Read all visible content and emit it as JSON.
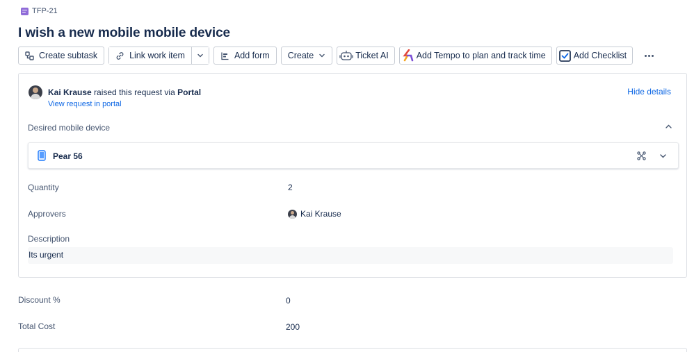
{
  "issue": {
    "key": "TFP-21",
    "title": "I wish a new mobile mobile device"
  },
  "toolbar": {
    "create_subtask": "Create subtask",
    "link_work_item": "Link work item",
    "add_form": "Add form",
    "create": "Create",
    "ticket_ai": "Ticket AI",
    "add_tempo": "Add Tempo to plan and track time",
    "add_checklist": "Add Checklist"
  },
  "request": {
    "requester_name": "Kai Krause",
    "raised_text": "raised this request via",
    "channel": "Portal",
    "view_link": "View request in portal",
    "hide_details": "Hide details"
  },
  "fields": {
    "desired_device_label": "Desired mobile device",
    "device_name": "Pear 56",
    "quantity_label": "Quantity",
    "quantity_value": "2",
    "approvers_label": "Approvers",
    "approver_name": "Kai Krause",
    "description_label": "Description",
    "description_value": "Its urgent",
    "discount_label": "Discount %",
    "discount_value": "0",
    "total_cost_label": "Total Cost",
    "total_cost_value": "200"
  },
  "icons": {
    "issue_type": "service-request-icon",
    "subtask": "subtask-icon",
    "link": "link-icon",
    "form": "form-icon",
    "robot": "robot-icon",
    "tempo": "tempo-logo-icon",
    "checklist": "checkbox-icon",
    "more": "more-icon",
    "phone": "phone-icon",
    "expand": "expand-icon"
  },
  "colors": {
    "link": "#0c66e4",
    "issue_type": "#8f6bd8",
    "text": "#172b4d",
    "muted": "#44546f"
  }
}
